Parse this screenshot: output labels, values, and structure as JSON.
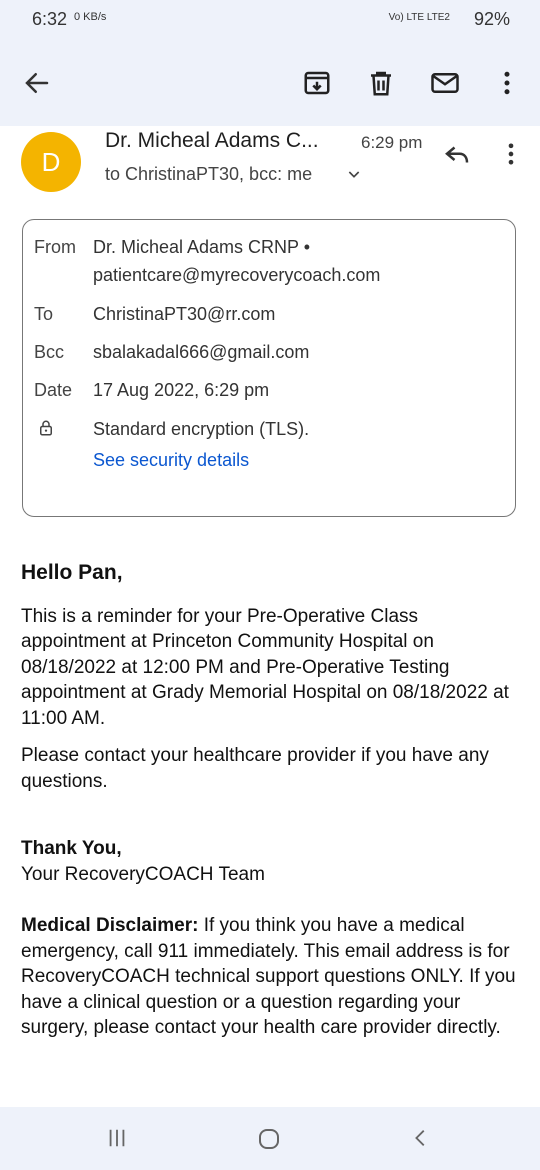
{
  "status_bar": {
    "time": "6:32",
    "net_speed": "0 KB/s",
    "network": "Vo) LTE LTE2",
    "battery": "92%"
  },
  "toolbar": {
    "back_icon": "arrow-left-icon",
    "archive_icon": "archive-icon",
    "delete_icon": "trash-icon",
    "unread_icon": "mail-icon",
    "more_icon": "more-vert-icon"
  },
  "email": {
    "avatar_letter": "D",
    "sender_short": "Dr. Micheal Adams C...",
    "time": "6:29 pm",
    "recipients_summary": "to ChristinaPT30, bcc: me",
    "details": {
      "from_label": "From",
      "from_name": "Dr. Micheal Adams CRNP •",
      "from_email": "patientcare@myrecoverycoach.com",
      "to_label": "To",
      "to_value": "ChristinaPT30@rr.com",
      "bcc_label": "Bcc",
      "bcc_value": "sbalakadal666@gmail.com",
      "date_label": "Date",
      "date_value": "17 Aug 2022, 6:29 pm",
      "encryption": "Standard encryption (TLS).",
      "security_link": "See security details"
    },
    "body": {
      "greeting": "Hello Pan,",
      "paragraph1": "This is a reminder for your Pre-Operative Class appointment at Princeton Community Hospital on 08/18/2022 at 12:00 PM and Pre-Operative Testing appointment at Grady Memorial Hospital on 08/18/2022 at 11:00 AM.",
      "paragraph2": "Please contact your healthcare provider if you have any questions.",
      "thanks": "Thank You,",
      "team": "Your RecoveryCOACH Team",
      "disclaimer_label": "Medical Disclaimer:",
      "disclaimer_text": " If you think you have a medical emergency, call 911 immediately. This email address is for RecoveryCOACH technical support questions ONLY. If you have a clinical question or a question regarding your surgery, please contact your health care provider directly."
    }
  },
  "colors": {
    "accent": "#0b57d0",
    "avatar": "#f4b400",
    "bar_background": "#eef2fa"
  }
}
